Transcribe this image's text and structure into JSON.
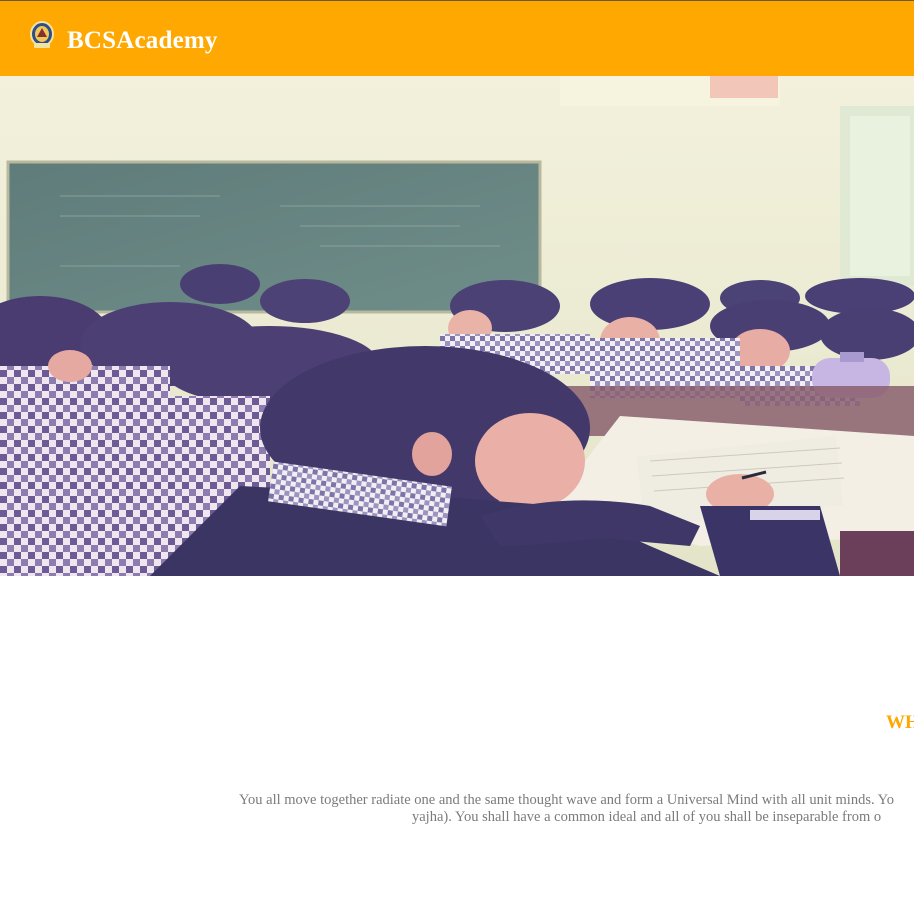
{
  "header": {
    "brand": "BCSAcademy",
    "logo_icon": "school-crest-icon",
    "background_color": "#ffa801"
  },
  "hero": {
    "image_icon": "classroom-photo"
  },
  "section": {
    "heading": "WH",
    "heading_color": "#ffa801",
    "paragraph_line1": "You all move together radiate one and the same thought wave and form a Universal Mind with all unit minds. Yo",
    "paragraph_line2": "yajha). You shall have a common ideal and all of you shall be inseparable from o"
  }
}
